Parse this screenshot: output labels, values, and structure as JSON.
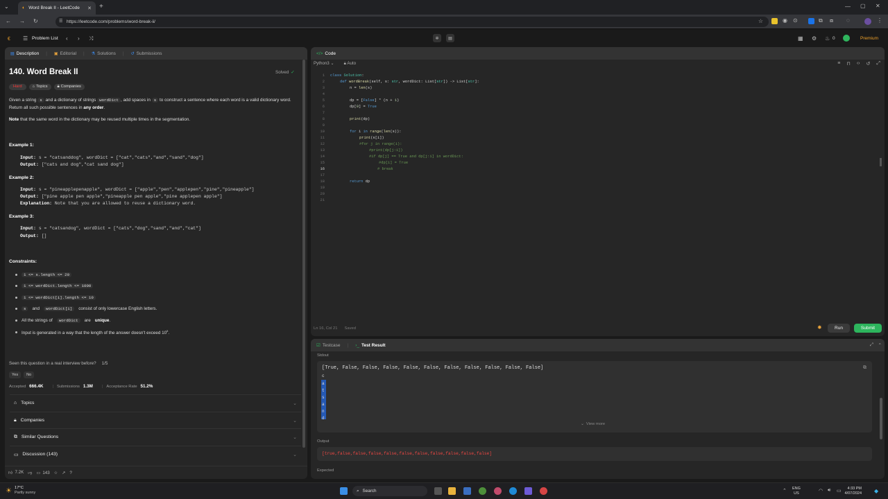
{
  "browser": {
    "tab_title": "Word Break II - LeetCode",
    "url": "https://leetcode.com/problems/word-break-ii/"
  },
  "nav": {
    "problem_list": "Problem List",
    "premium": "Premium",
    "streak": "0"
  },
  "desc_panel": {
    "tabs": [
      "Description",
      "Editorial",
      "Solutions",
      "Submissions"
    ],
    "title": "140. Word Break II",
    "status": "Solved",
    "difficulty": "Hard",
    "tag_topics": "Topics",
    "tag_companies": "Companies",
    "para1_a": "Given a string",
    "para1_s": "s",
    "para1_b": "and a dictionary of strings",
    "para1_wd": "wordDict",
    "para1_c": ", add spaces in",
    "para1_s2": "s",
    "para1_d": "to construct a sentence where each word is a valid dictionary",
    "para1_e": "word. Return all such possible sentences in",
    "para1_f": "any order",
    "para1_g": ".",
    "note_bold": "Note",
    "note_rest": "that the same word in the dictionary may be reused multiple times in the segmentation.",
    "ex1_title": "Example 1:",
    "ex1_input_label": "Input:",
    "ex1_input": "s = \"catsanddog\", wordDict = [\"cat\",\"cats\",\"and\",\"sand\",\"dog\"]",
    "ex1_output_label": "Output:",
    "ex1_output": "[\"cats and dog\",\"cat sand dog\"]",
    "ex2_title": "Example 2:",
    "ex2_input_label": "Input:",
    "ex2_input": "s = \"pineapplepenapple\", wordDict = [\"apple\",\"pen\",\"applepen\",\"pine\",\"pineapple\"]",
    "ex2_output_label": "Output:",
    "ex2_output": "[\"pine apple pen apple\",\"pineapple pen apple\",\"pine applepen apple\"]",
    "ex2_expl_label": "Explanation:",
    "ex2_expl": "Note that you are allowed to reuse a dictionary word.",
    "ex3_title": "Example 3:",
    "ex3_input_label": "Input:",
    "ex3_input": "s = \"catsandog\", wordDict = [\"cats\",\"dog\",\"sand\",\"and\",\"cat\"]",
    "ex3_output_label": "Output:",
    "ex3_output": "[]",
    "constraints_title": "Constraints:",
    "c1": "1 <= s.length <= 20",
    "c2": "1 <= wordDict.length <= 1000",
    "c3": "1 <= wordDict[i].length <= 10",
    "c4_a": "s",
    "c4_and": "and",
    "c4_b": "wordDict[i]",
    "c4_rest": "consist of only lowercase English letters.",
    "c5_a": "All the strings of",
    "c5_code": "wordDict",
    "c5_are": "are",
    "c5_bold": "unique",
    "c5_end": ".",
    "c6": "Input is generated in a way that the length of the answer doesn't exceed 10",
    "c6_sup": "5",
    "c6_end": ".",
    "interview_q": "Seen this question in a real interview before?",
    "interview_frac": "1/5",
    "yes": "Yes",
    "no": "No",
    "accepted_label": "Accepted",
    "accepted_val": "666.4K",
    "submissions_label": "Submissions",
    "submissions_val": "1.3M",
    "rate_label": "Acceptance Rate",
    "rate_val": "51.2%",
    "acc_topics": "Topics",
    "acc_companies": "Companies",
    "acc_similar": "Similar Questions",
    "acc_discussion": "Discussion (143)",
    "likes": "7.2K",
    "comments": "143"
  },
  "code_panel": {
    "title": "Code",
    "language": "Python3",
    "auto": "Auto",
    "status_pos": "Ln 16, Col 21",
    "status_saved": "Saved",
    "run": "Run",
    "submit": "Submit"
  },
  "result_panel": {
    "tab_testcase": "Testcase",
    "tab_result": "Test Result",
    "stdout_label": "Stdout",
    "stdout_line": "[True, False, False, False, False, False, False, False, False, False, False]",
    "stdout_chars": [
      "c",
      "a",
      "t",
      "s",
      "a",
      "n",
      "d"
    ],
    "view_more": "View more",
    "output_label": "Output",
    "output_val": "[true,false,false,false,false,false,false,false,false,false,false]",
    "expected_label": "Expected"
  },
  "taskbar": {
    "weather_temp": "17°C",
    "weather_desc": "Partly sunny",
    "search": "Search",
    "lang1": "ENG",
    "lang2": "US",
    "time": "4:33 PM",
    "date": "4/07/2024"
  }
}
